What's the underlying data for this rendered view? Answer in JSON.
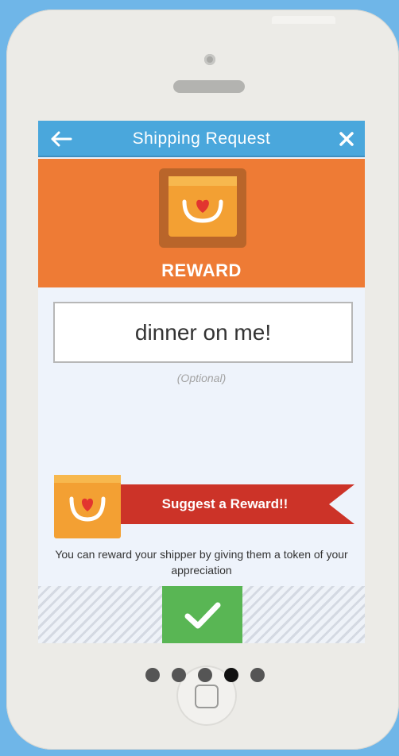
{
  "navbar": {
    "title": "Shipping Request",
    "back_icon": "arrow-left-icon",
    "close_icon": "close-icon"
  },
  "reward": {
    "icon": "gift-bag-heart-icon",
    "title": "REWARD",
    "input_value": "dinner on me!",
    "optional_label": "(Optional)"
  },
  "suggest": {
    "icon": "gift-bag-heart-icon",
    "label": "Suggest a Reward!!",
    "hint": "You can reward your shipper by giving them a token of your appreciation"
  },
  "confirm": {
    "icon": "checkmark-icon"
  },
  "pager": {
    "total": 5,
    "active_index": 3
  },
  "colors": {
    "navbar": "#4aa7dc",
    "reward_banner": "#ee7b35",
    "ribbon": "#cc3328",
    "confirm": "#59b654",
    "background": "#6fb6e8"
  }
}
